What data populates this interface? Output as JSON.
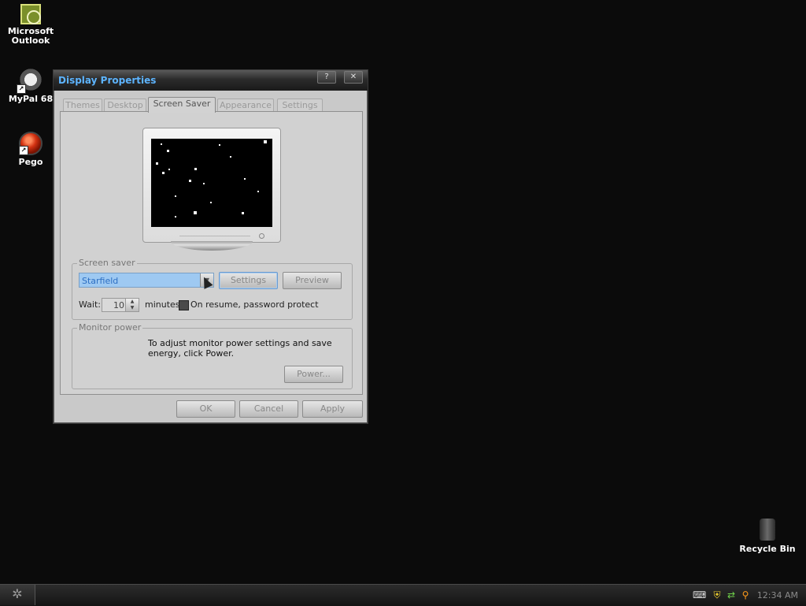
{
  "desktop": {
    "icons": [
      {
        "label_line1": "Microsoft",
        "label_line2": "Outlook",
        "icon": "outlook-icon"
      },
      {
        "label_line1": "MyPal 68",
        "label_line2": "",
        "icon": "mypal-icon"
      },
      {
        "label_line1": "Pego",
        "label_line2": "",
        "icon": "pego-icon"
      },
      {
        "label_line1": "Recycle Bin",
        "label_line2": "",
        "icon": "recycle-bin-icon"
      }
    ]
  },
  "window": {
    "title": "Display Properties",
    "help_label": "?",
    "close_label": "✕",
    "tabs": [
      {
        "label": "Themes",
        "active": false
      },
      {
        "label": "Desktop",
        "active": false
      },
      {
        "label": "Screen Saver",
        "active": true
      },
      {
        "label": "Appearance",
        "active": false
      },
      {
        "label": "Settings",
        "active": false
      }
    ],
    "screen_saver": {
      "group_label": "Screen saver",
      "selected": "Starfield",
      "settings_label": "Settings",
      "preview_label": "Preview",
      "wait_label": "Wait:",
      "wait_value": "10",
      "minutes_label": "minutes",
      "password_label": "On resume, password protect",
      "password_checked": false
    },
    "monitor_power": {
      "group_label": "Monitor power",
      "note": "To adjust monitor power settings and save energy, click Power.",
      "power_label": "Power..."
    },
    "buttons": {
      "ok": "OK",
      "cancel": "Cancel",
      "apply": "Apply"
    }
  },
  "taskbar": {
    "clock": "12:34 AM",
    "tray_icons": [
      "keyboard-icon",
      "shield-icon",
      "network-icon",
      "search-icon"
    ]
  },
  "colors": {
    "desktop_bg": "#0b0b0b",
    "title_text": "#5db4ff",
    "selection": "#9ec9f2"
  }
}
